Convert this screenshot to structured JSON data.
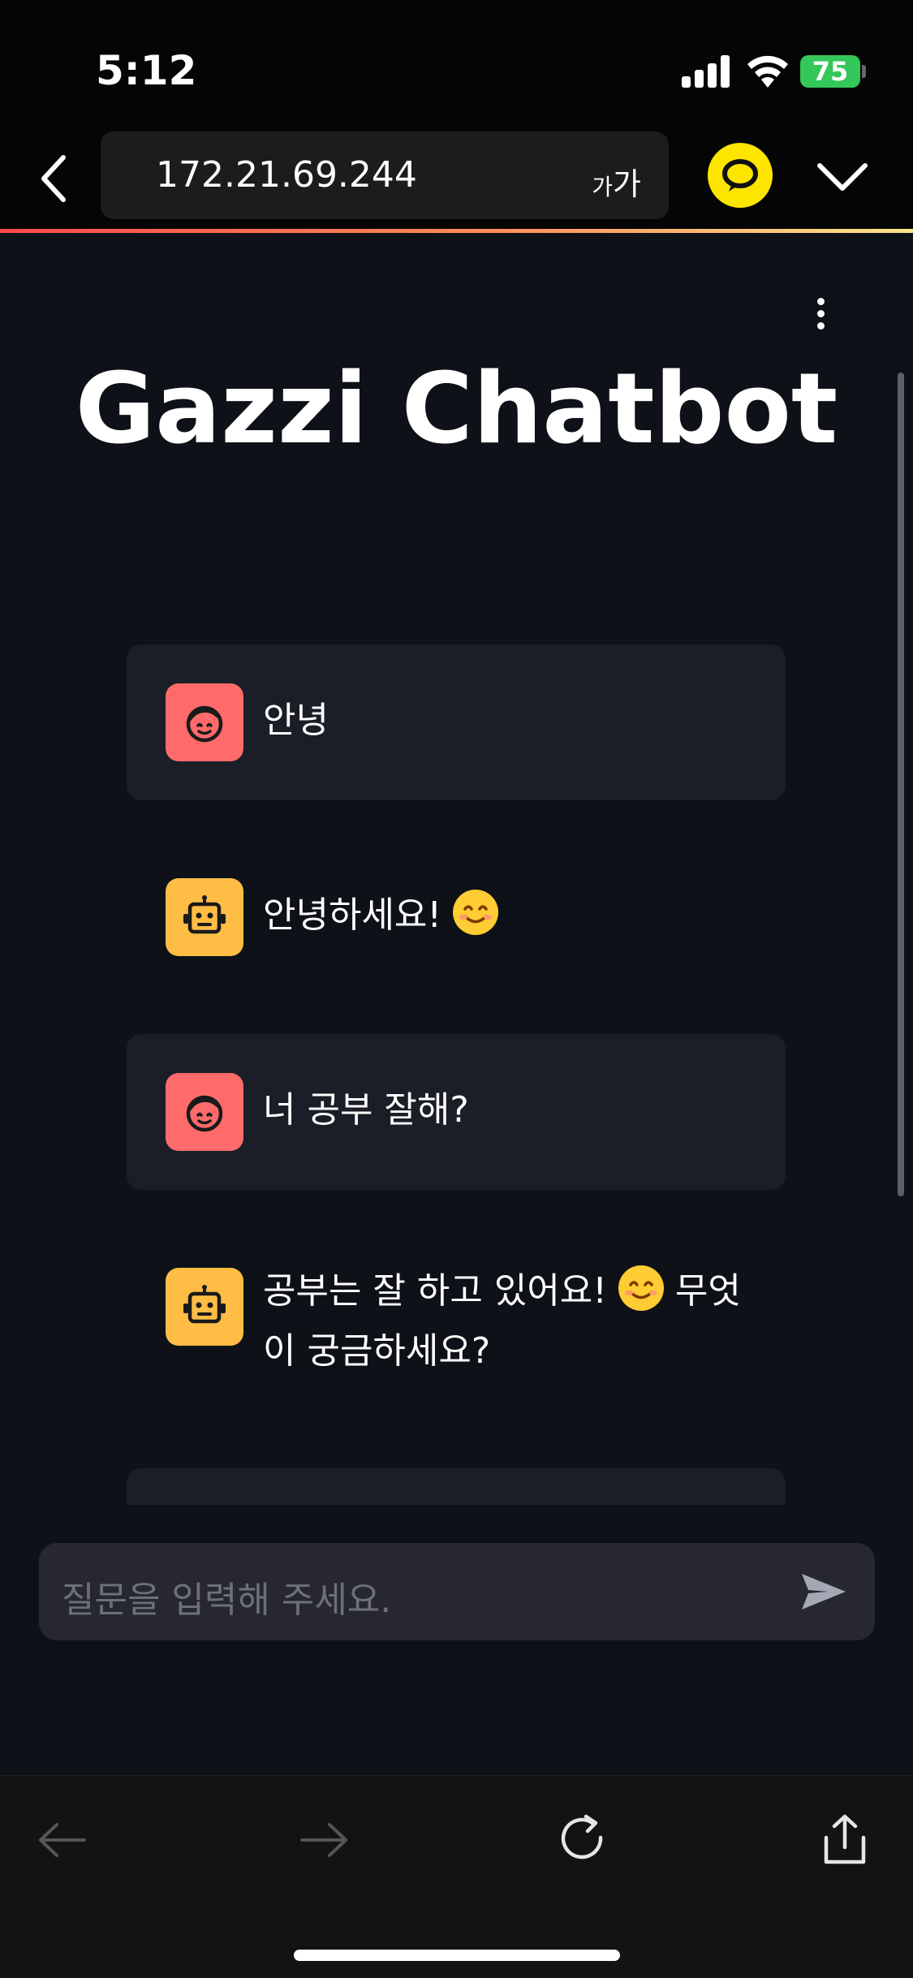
{
  "status": {
    "time": "5:12",
    "battery": "75"
  },
  "browser": {
    "url": "172.21.69.244",
    "text_size_small": "가",
    "text_size_large": "가"
  },
  "page": {
    "title": "Gazzi Chatbot"
  },
  "messages": [
    {
      "role": "user",
      "text": "안녕"
    },
    {
      "role": "bot",
      "text": "안녕하세요!"
    },
    {
      "role": "user",
      "text": "너 공부 잘해?"
    },
    {
      "role": "bot",
      "text_before": "공부는 잘 하고 있어요!",
      "text_after": "무엇이 궁금하세요?"
    }
  ],
  "input": {
    "placeholder": "질문을 입력해 주세요."
  },
  "colors": {
    "background": "#0e1117",
    "user_avatar": "#ff6b6b",
    "bot_avatar": "#ffbd45",
    "user_bubble": "#1b1e26",
    "kakao_yellow": "#fee500"
  },
  "icons": {
    "user_avatar": "smiling-face-icon",
    "bot_avatar": "robot-icon",
    "send": "send-arrow-icon"
  }
}
